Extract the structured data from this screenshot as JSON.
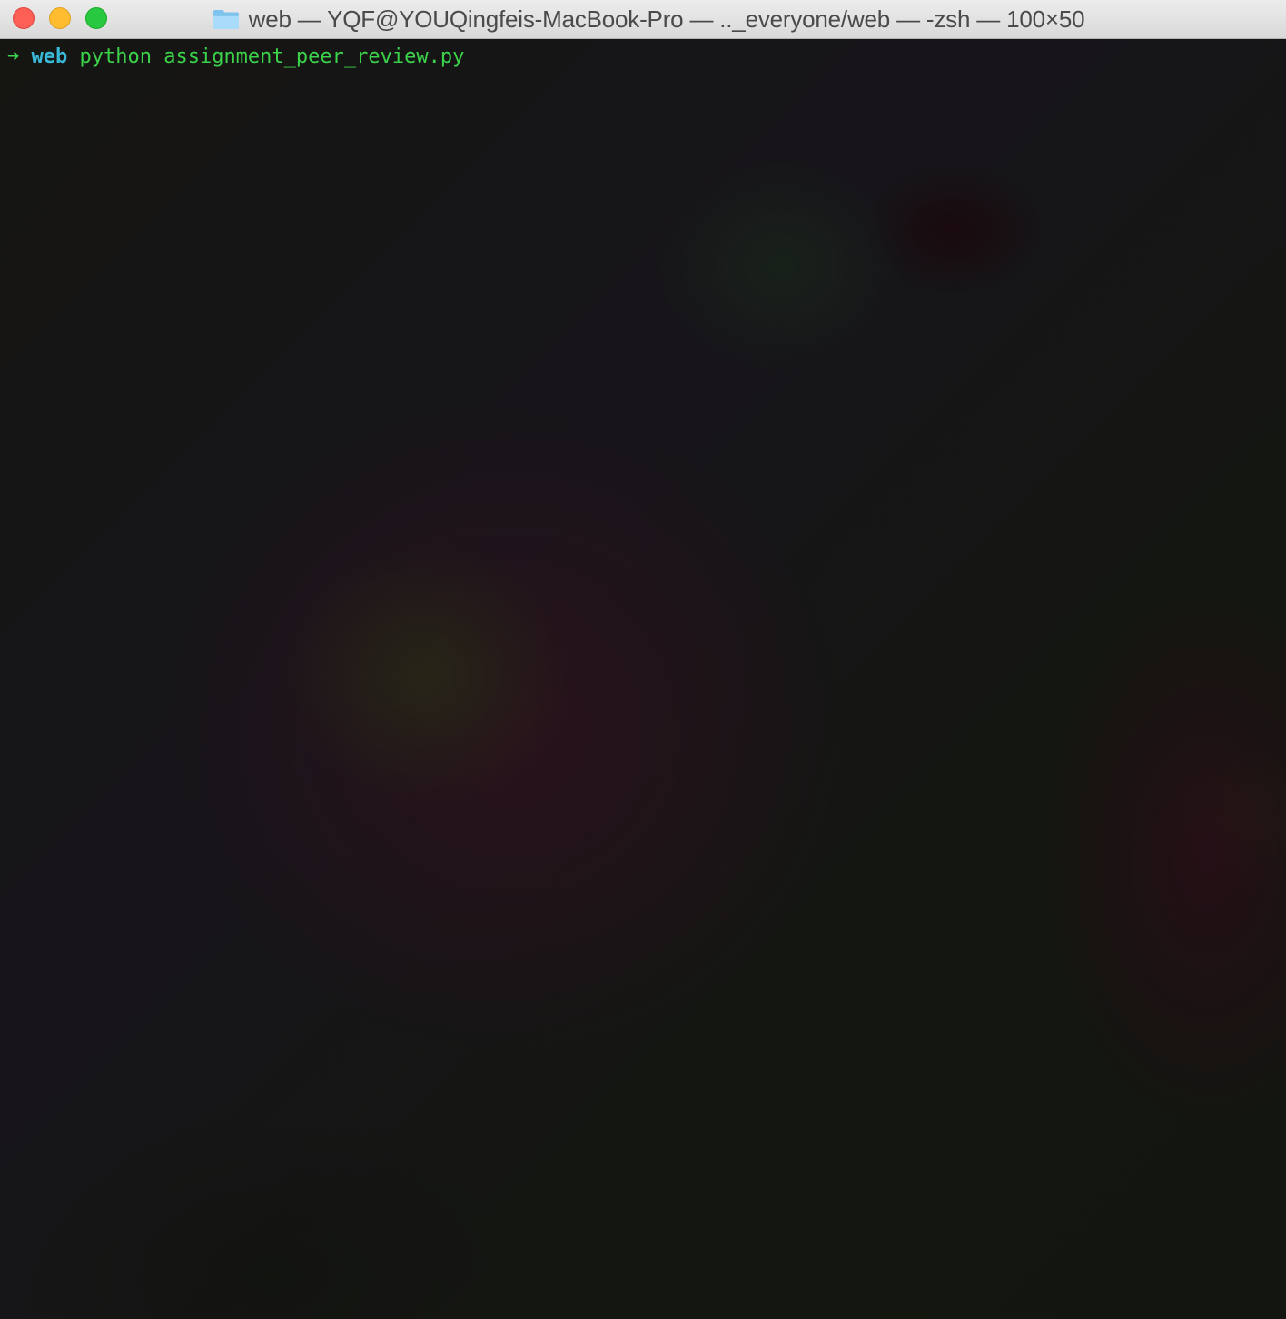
{
  "window": {
    "title": "web — YQF@YOUQingfeis-MacBook-Pro — .._everyone/web — -zsh — 100×50",
    "icons": {
      "close": "close-button",
      "minimize": "minimize-button",
      "zoom": "zoom-button",
      "title_icon": "folder-icon"
    },
    "colors": {
      "close": "#fd5f57",
      "minimize": "#febc2e",
      "zoom": "#28c840"
    }
  },
  "terminal": {
    "prompt_arrow": "➜",
    "prompt_dir": "web",
    "command": "python assignment_peer_review.py",
    "colors": {
      "prompt": "#3bd34a",
      "dir": "#39b8d8",
      "command": "#3bd34a"
    }
  }
}
